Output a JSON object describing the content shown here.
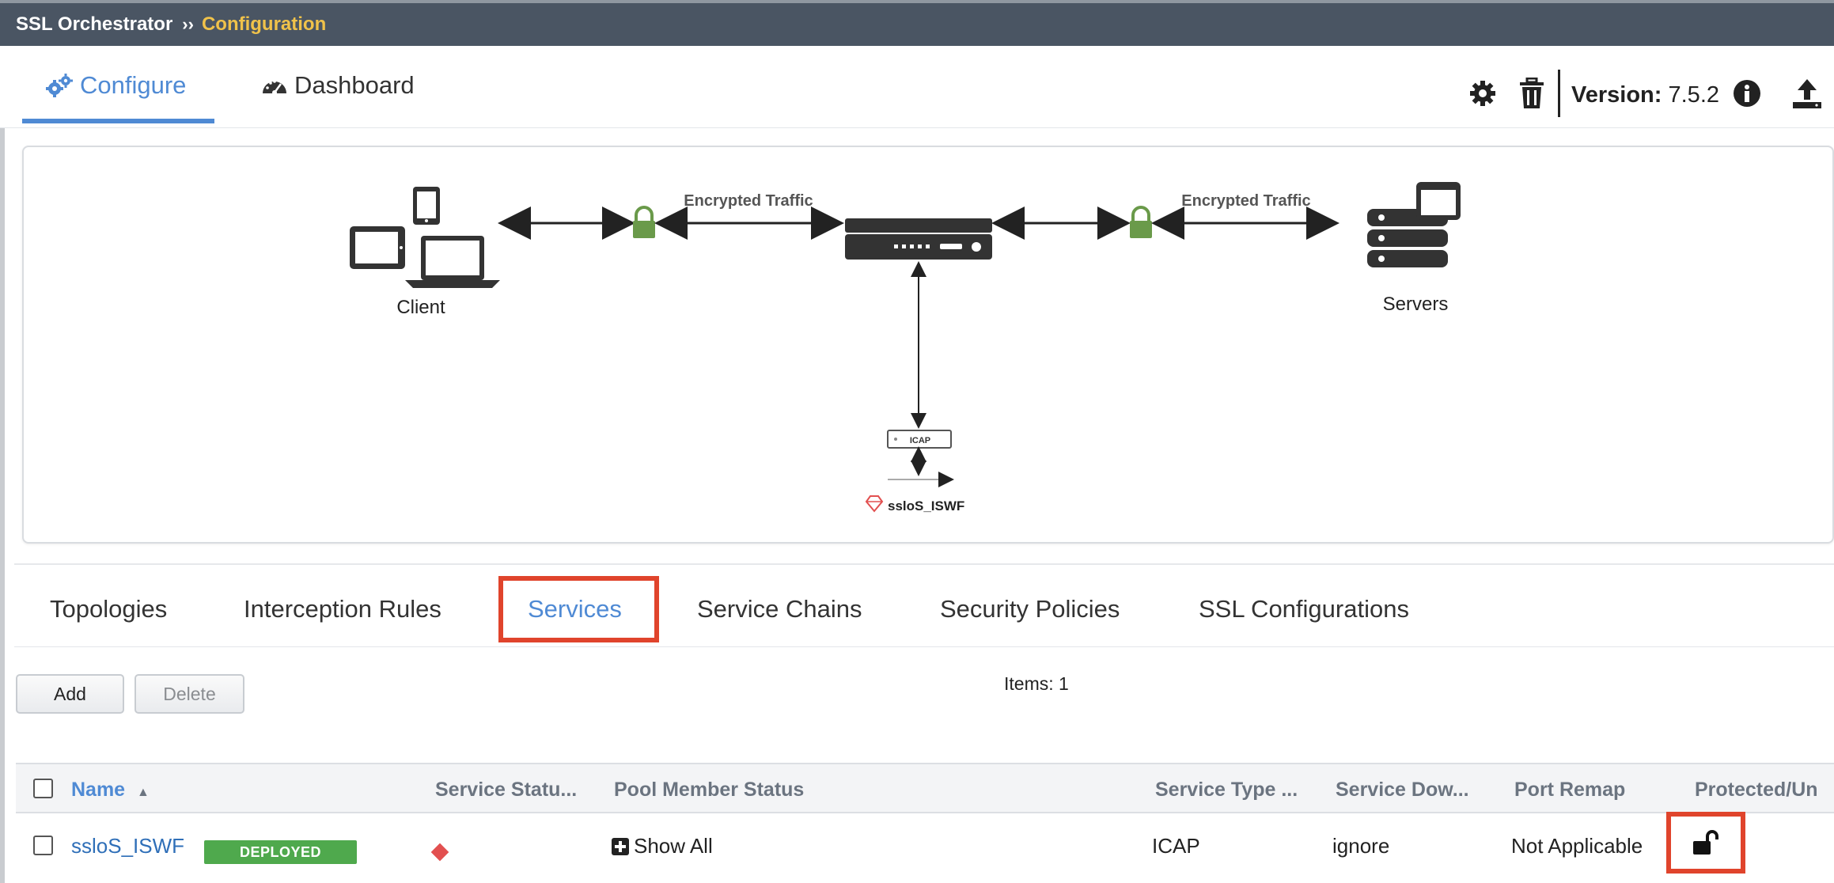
{
  "titlebar": {
    "app_name": "SSL Orchestrator",
    "separator": "››",
    "current": "Configuration"
  },
  "nav": {
    "configure_label": "Configure",
    "dashboard_label": "Dashboard",
    "active": "Configure"
  },
  "toolbar": {
    "version_label": "Version:",
    "version_value": "7.5.2",
    "icons": [
      "gear-icon",
      "trash-icon",
      "info-icon",
      "upload-icon"
    ]
  },
  "diagram": {
    "client_label": "Client",
    "servers_label": "Servers",
    "encrypted_left": "Encrypted Traffic",
    "encrypted_right": "Encrypted Traffic",
    "icap_label": "ICAP",
    "service_label": "ssloS_ISWF"
  },
  "subtabs": {
    "items": [
      "Topologies",
      "Interception Rules",
      "Services",
      "Service Chains",
      "Security Policies",
      "SSL Configurations"
    ],
    "active": "Services"
  },
  "actions": {
    "add_label": "Add",
    "delete_label": "Delete",
    "items_count": "Items: 1"
  },
  "table": {
    "columns": [
      "Name",
      "Service Statu...",
      "Pool Member Status",
      "Service Type ...",
      "Service Dow...",
      "Port Remap",
      "Protected/Un"
    ],
    "sort_indicator": "▲",
    "rows": [
      {
        "name": "ssloS_ISWF",
        "badge": "DEPLOYED",
        "pool_member_status": "Show All",
        "service_type": "ICAP",
        "service_down": "ignore",
        "port_remap": "Not Applicable"
      }
    ]
  },
  "colors": {
    "accent": "#4f8ad4",
    "titlebar_bg": "#4a5563",
    "crumb": "#f0c24a",
    "deployed": "#4fa94d",
    "status_error": "#e25050",
    "lock_green": "#6a9a4a",
    "highlight_box": "#e0442c"
  }
}
